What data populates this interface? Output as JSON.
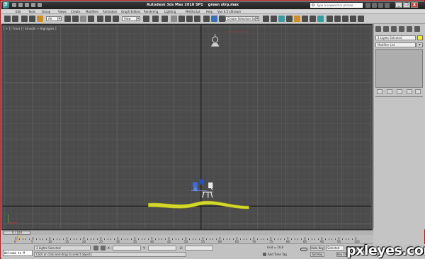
{
  "window": {
    "app_title": "Autodesk 3ds Max  2010 SP1",
    "file_name": "green strp.max",
    "search_placeholder": "Type a keyword or phrase",
    "minimize": "_",
    "restore": "❐",
    "close": "x"
  },
  "menu": {
    "items": [
      "Edit",
      "Tools",
      "Group",
      "Views",
      "Create",
      "Modifiers",
      "Animation",
      "Graph Editors",
      "Rendering",
      "Lighting",
      "MAXScript",
      "Help",
      "Vue 6.5 xStream"
    ]
  },
  "toolbar": {
    "selection_filter": "All",
    "view_dropdown": "View",
    "named_selection": "Create Selection Set"
  },
  "viewport": {
    "label": "[ + ] [ Front ] [ Smooth + Highlights ]",
    "background": "#4b4b4b",
    "object_color": "#d4d82a"
  },
  "command_panel": {
    "name_field": "3 Lights Selected",
    "modifier_list": "Modifier List",
    "swatch_color": "#f4f422"
  },
  "timeline": {
    "frame_display": "0 / 100",
    "ticks": [
      "0",
      "5",
      "10",
      "15",
      "20",
      "25",
      "30",
      "35",
      "40",
      "45",
      "50",
      "55",
      "60",
      "65",
      "70",
      "75",
      "80",
      "85",
      "90",
      "95",
      "100"
    ]
  },
  "status": {
    "maxscript_listener": "Welcome to M",
    "selection_info": "3 Lights Selected",
    "prompt": "Click or click-and-drag to select objects",
    "coord_x_label": "X:",
    "coord_y_label": "Y:",
    "coord_z_label": "Z:",
    "grid": "Grid = 10,0",
    "add_time_tag": "Add Time Tag",
    "auto_key": "Auto Key",
    "selected": "Selected",
    "set_key": "Set Key",
    "key_filters": "Key Filters..."
  },
  "watermark": "pxleyes.com"
}
